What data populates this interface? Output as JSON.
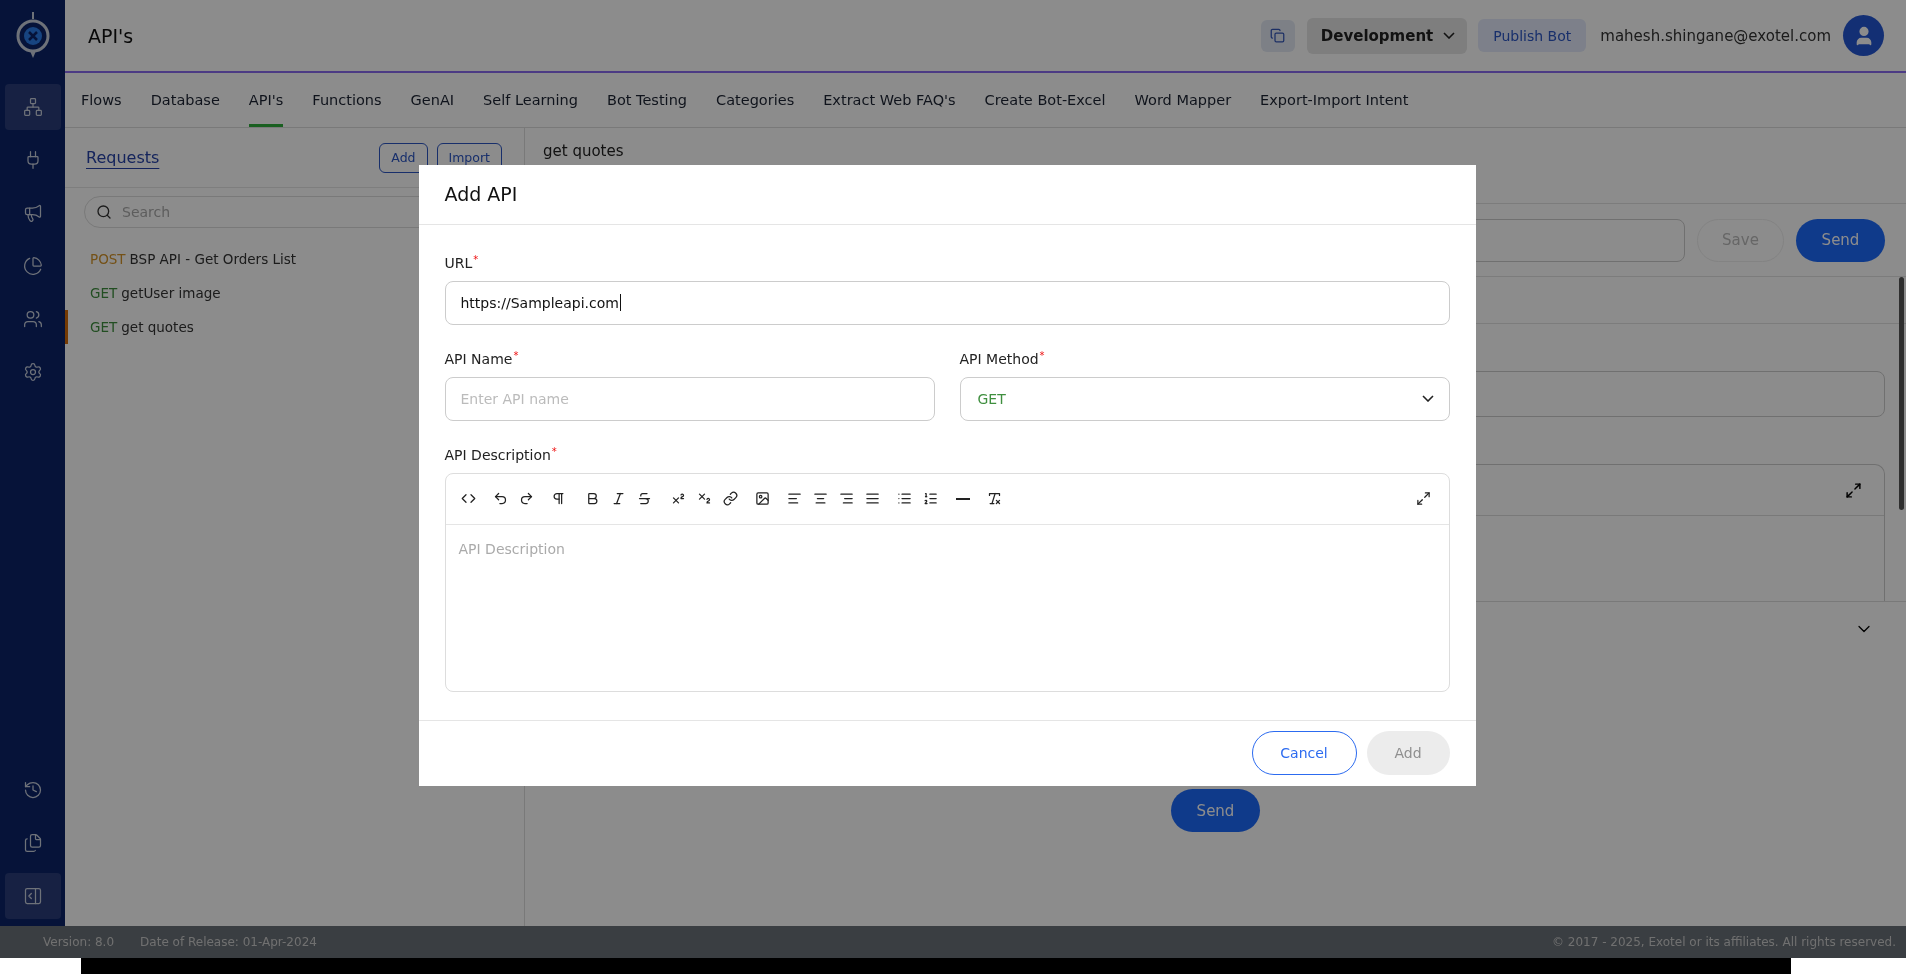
{
  "top_bar": {
    "page_title": "API's",
    "environment": "Development",
    "publish_button": "Publish Bot",
    "user_email": "mahesh.shingane@exotel.com"
  },
  "sidebar": {
    "items": [
      {
        "selected": true
      },
      {
        "selected": false
      },
      {
        "selected": false
      },
      {
        "selected": false
      },
      {
        "selected": false
      },
      {
        "selected": false
      }
    ],
    "bottom_items": [
      {
        "selected": false
      },
      {
        "selected": false
      },
      {
        "selected": true
      }
    ]
  },
  "tabs": [
    {
      "label": "Flows",
      "selected": false
    },
    {
      "label": "Database",
      "selected": false
    },
    {
      "label": "API's",
      "selected": true
    },
    {
      "label": "Functions",
      "selected": false
    },
    {
      "label": "GenAI",
      "selected": false
    },
    {
      "label": "Self Learning",
      "selected": false
    },
    {
      "label": "Bot Testing",
      "selected": false
    },
    {
      "label": "Categories",
      "selected": false
    },
    {
      "label": "Extract Web FAQ's",
      "selected": false
    },
    {
      "label": "Create Bot-Excel",
      "selected": false
    },
    {
      "label": "Word Mapper",
      "selected": false
    },
    {
      "label": "Export-Import Intent",
      "selected": false
    }
  ],
  "requests_panel": {
    "title": "Requests",
    "add_button": "Add",
    "import_button": "Import",
    "search": {
      "placeholder": "Search"
    },
    "items": [
      {
        "method": "POST",
        "kind": "post",
        "name": "BSP API - Get Orders List",
        "selected": false
      },
      {
        "method": "GET",
        "kind": "get",
        "name": "getUser image",
        "selected": false
      },
      {
        "method": "GET",
        "kind": "get",
        "name": "get quotes",
        "selected": true
      }
    ]
  },
  "request_editor": {
    "title": "get quotes",
    "save_button": {
      "label": "Save",
      "disabled": true
    },
    "send_button": "Send",
    "bottom_send_button": "Send"
  },
  "modal": {
    "title": "Add API",
    "url": {
      "label": "URL",
      "required_mark": "*",
      "value": "https://Sampleapi.com"
    },
    "api_name": {
      "label": "API Name",
      "required_mark": "*",
      "placeholder": "Enter API name"
    },
    "api_method": {
      "label": "API Method",
      "required_mark": "*",
      "value": "GET"
    },
    "description": {
      "label": "API Description",
      "required_mark": "*",
      "placeholder": "API Description"
    },
    "cancel_button": "Cancel",
    "add_button": {
      "label": "Add",
      "disabled": true
    }
  },
  "footer": {
    "version": "Version: 8.0",
    "release": "Date of Release: 01-Apr-2024",
    "copyright": "© 2017 - 2025, Exotel or its affiliates. All rights reserved."
  }
}
